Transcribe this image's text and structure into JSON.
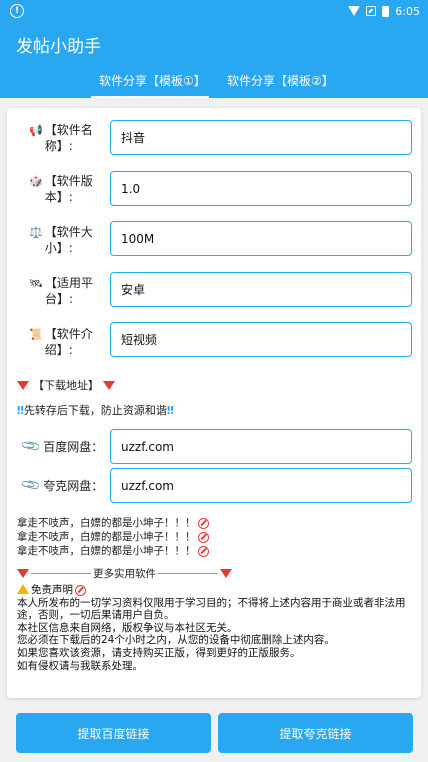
{
  "statusbar": {
    "time": "6:05"
  },
  "appbar": {
    "title": "发帖小助手"
  },
  "tabs": [
    {
      "label": "软件分享【模板①】",
      "active": true
    },
    {
      "label": "软件分享【模板②】",
      "active": false
    }
  ],
  "fields": [
    {
      "icon": "📢",
      "label": "【软件名称】:",
      "value": "抖音"
    },
    {
      "icon": "🎲",
      "label": "【软件版本】:",
      "value": "1.0"
    },
    {
      "icon": "⚖️",
      "label": "【软件大小】:",
      "value": "100M"
    },
    {
      "icon": "🛰",
      "label": "【适用平台】:",
      "value": "安卓"
    },
    {
      "icon": "📜",
      "label": "【软件介绍】:",
      "value": "短视频"
    }
  ],
  "download": {
    "title": "【下载地址】",
    "hint": "先转存后下载，防止资源和谐",
    "baidu_label": "百度网盘：",
    "baidu_value": "uzzf.com",
    "quark_label": "夸克网盘：",
    "quark_value": "uzzf.com"
  },
  "warnings": [
    "拿走不吱声，白嫖的都是小坤子！！！",
    "拿走不吱声，白嫖的都是小坤子！！！",
    "拿走不吱声，白嫖的都是小坤子！！！"
  ],
  "more_text": "更多实用软件",
  "disclaimer": {
    "title": "免责声明",
    "lines": [
      "本人所发布的一切学习资料仅限用于学习目的；不得将上述内容用于商业或者非法用途，否则，一切后果请用户自负。",
      "本社区信息来自网络，版权争议与本社区无关。",
      "您必须在下载后的24个小时之内，从您的设备中彻底删除上述内容。",
      "如果您喜欢该资源，请支持购买正版，得到更好的正版服务。",
      "如有侵权请与我联系处理。"
    ]
  },
  "buttons": {
    "baidu": "提取百度链接",
    "quark": "提取夸克链接"
  }
}
